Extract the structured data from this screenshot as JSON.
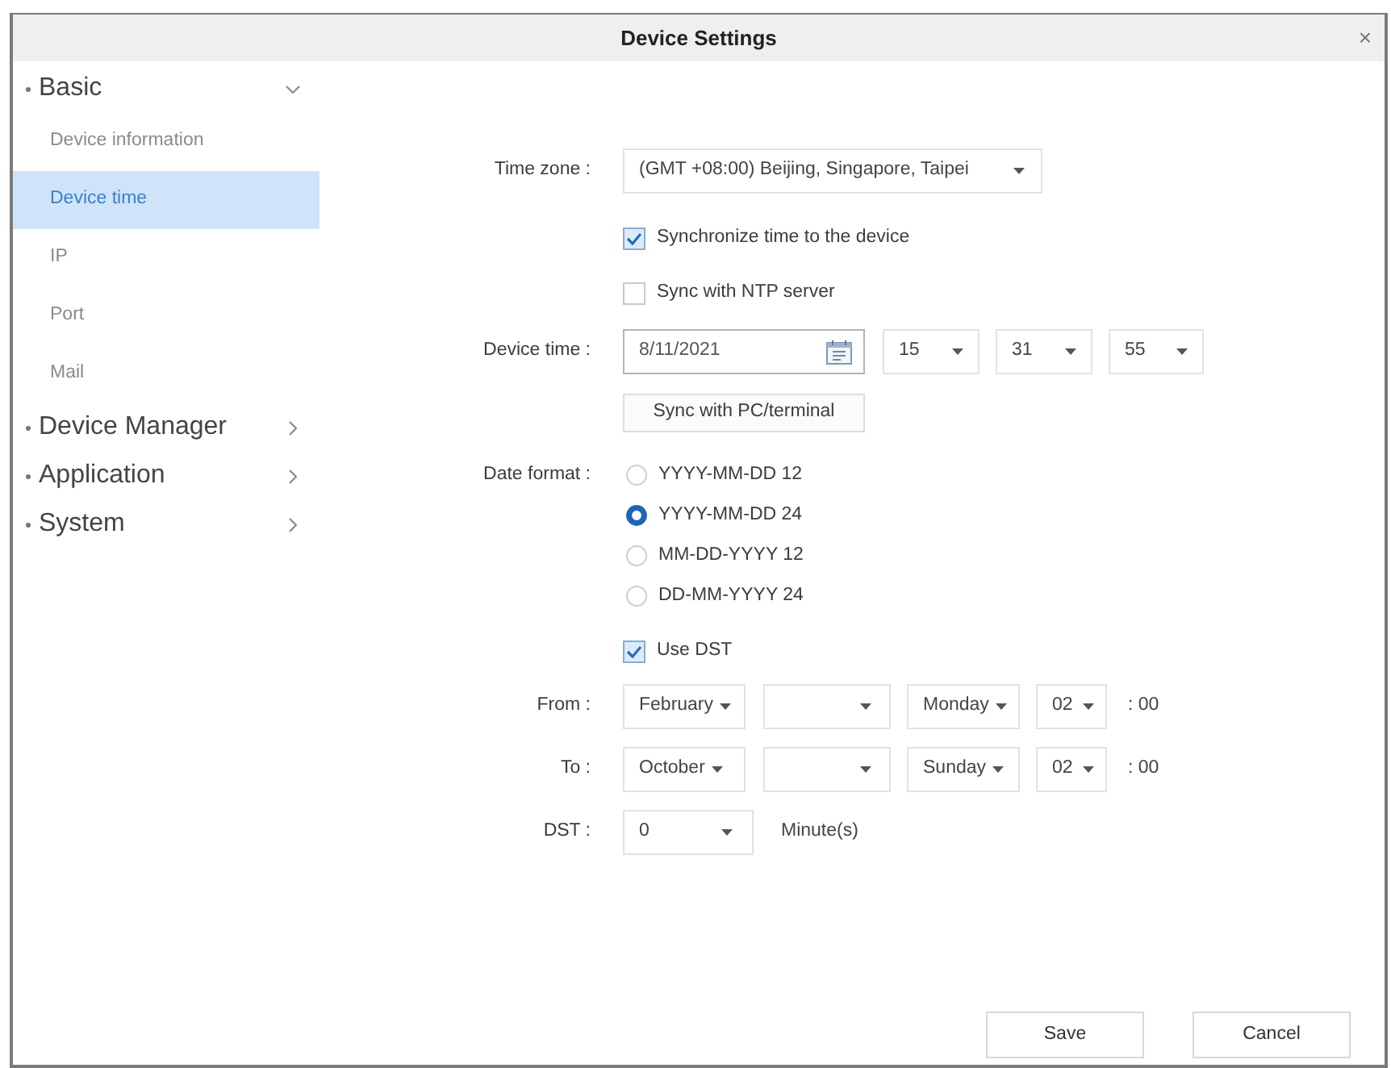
{
  "window": {
    "title": "Device Settings",
    "close": "×"
  },
  "sidebar": {
    "groups": [
      {
        "label": "Basic",
        "expanded": true,
        "children": [
          {
            "label": "Device information",
            "selected": false
          },
          {
            "label": "Device time",
            "selected": true
          },
          {
            "label": "IP",
            "selected": false
          },
          {
            "label": "Port",
            "selected": false
          },
          {
            "label": "Mail",
            "selected": false
          }
        ]
      },
      {
        "label": "Device Manager",
        "expanded": false
      },
      {
        "label": "Application",
        "expanded": false
      },
      {
        "label": "System",
        "expanded": false
      }
    ]
  },
  "form": {
    "time_zone": {
      "label": "Time zone :",
      "value": "(GMT +08:00) Beijing, Singapore, Taipei"
    },
    "sync_options": [
      {
        "label": "Synchronize time to the device",
        "checked": true
      },
      {
        "label": "Sync with NTP server",
        "checked": false
      }
    ],
    "device_time": {
      "label": "Device time :",
      "date": "8/11/2021",
      "hour": "15",
      "minute": "31",
      "second": "55"
    },
    "sync_button": "Sync with PC/terminal",
    "date_format": {
      "label": "Date format :",
      "options": [
        {
          "label": "YYYY-MM-DD 12",
          "selected": false
        },
        {
          "label": "YYYY-MM-DD 24",
          "selected": true
        },
        {
          "label": "MM-DD-YYYY 12",
          "selected": false
        },
        {
          "label": "DD-MM-YYYY 24",
          "selected": false
        }
      ]
    },
    "use_dst": {
      "label": "Use DST",
      "checked": true
    },
    "dst_ranges": [
      {
        "label": "From :",
        "month": "February",
        "weekday": "Monday",
        "hour": "02",
        "minutes": ": 00"
      },
      {
        "label": "To :",
        "month": "October",
        "weekday": "Sunday",
        "hour": "02",
        "minutes": ": 00"
      }
    ],
    "dst_offset": {
      "label": "DST :",
      "value": "0",
      "unit": "Minute(s)"
    }
  },
  "buttons": [
    {
      "label": "Save"
    },
    {
      "label": "Cancel"
    }
  ]
}
